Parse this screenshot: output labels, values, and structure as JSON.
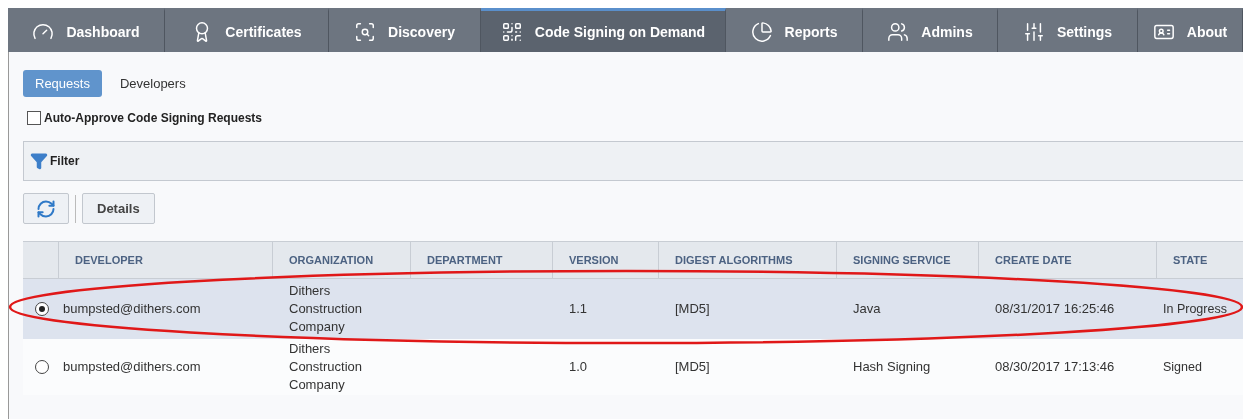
{
  "nav": [
    {
      "label": "Dashboard",
      "selected": false
    },
    {
      "label": "Certificates",
      "selected": false
    },
    {
      "label": "Discovery",
      "selected": false
    },
    {
      "label": "Code Signing on Demand",
      "selected": true
    },
    {
      "label": "Reports",
      "selected": false
    },
    {
      "label": "Admins",
      "selected": false
    },
    {
      "label": "Settings",
      "selected": false
    },
    {
      "label": "About",
      "selected": false
    }
  ],
  "subtabs": [
    {
      "label": "Requests",
      "selected": true
    },
    {
      "label": "Developers",
      "selected": false
    }
  ],
  "auto_approve": {
    "label": "Auto-Approve Code Signing Requests",
    "checked": false
  },
  "filter": {
    "label": "Filter"
  },
  "toolbar": {
    "details": "Details"
  },
  "table": {
    "columns": [
      "DEVELOPER",
      "ORGANIZATION",
      "DEPARTMENT",
      "VERSION",
      "DIGEST ALGORITHMS",
      "SIGNING SERVICE",
      "CREATE DATE",
      "STATE"
    ],
    "rows": [
      {
        "selected": true,
        "cells": [
          "bumpsted@dithers.com",
          "Dithers Construction Company",
          "",
          "1.1",
          "[MD5]",
          "Java",
          "08/31/2017 16:25:46",
          "In Progress"
        ]
      },
      {
        "selected": false,
        "cells": [
          "bumpsted@dithers.com",
          "Dithers Construction Company",
          "",
          "1.0",
          "[MD5]",
          "Hash Signing",
          "08/30/2017 17:13:46",
          "Signed"
        ]
      }
    ]
  }
}
